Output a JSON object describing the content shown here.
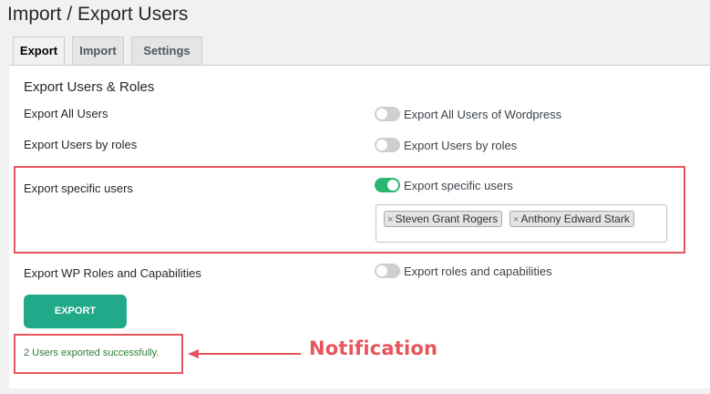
{
  "page": {
    "title": "Import / Export Users"
  },
  "tabs": [
    {
      "label": "Export",
      "active": true
    },
    {
      "label": "Import",
      "active": false
    },
    {
      "label": "Settings",
      "active": false
    }
  ],
  "section": {
    "title": "Export Users & Roles"
  },
  "rows": [
    {
      "label": "Export All Users",
      "toggle_label": "Export All Users of Wordpress",
      "enabled": false
    },
    {
      "label": "Export Users by roles",
      "toggle_label": "Export Users by roles",
      "enabled": false
    },
    {
      "label": "Export specific users",
      "toggle_label": "Export specific users",
      "enabled": true
    },
    {
      "label": "Export WP Roles and Capabilities",
      "toggle_label": "Export roles and capabilities",
      "enabled": false
    }
  ],
  "selected_users": [
    "Steven Grant Rogers",
    "Anthony Edward Stark"
  ],
  "export_button": {
    "label": "EXPORT"
  },
  "notice": {
    "text": "2 Users exported successfully."
  },
  "annotation": {
    "text": "Notification"
  },
  "colors": {
    "accent": "#22a98a",
    "toggle_on": "#2bb673",
    "highlight": "#e8545c",
    "notice": "#2e7d32"
  }
}
